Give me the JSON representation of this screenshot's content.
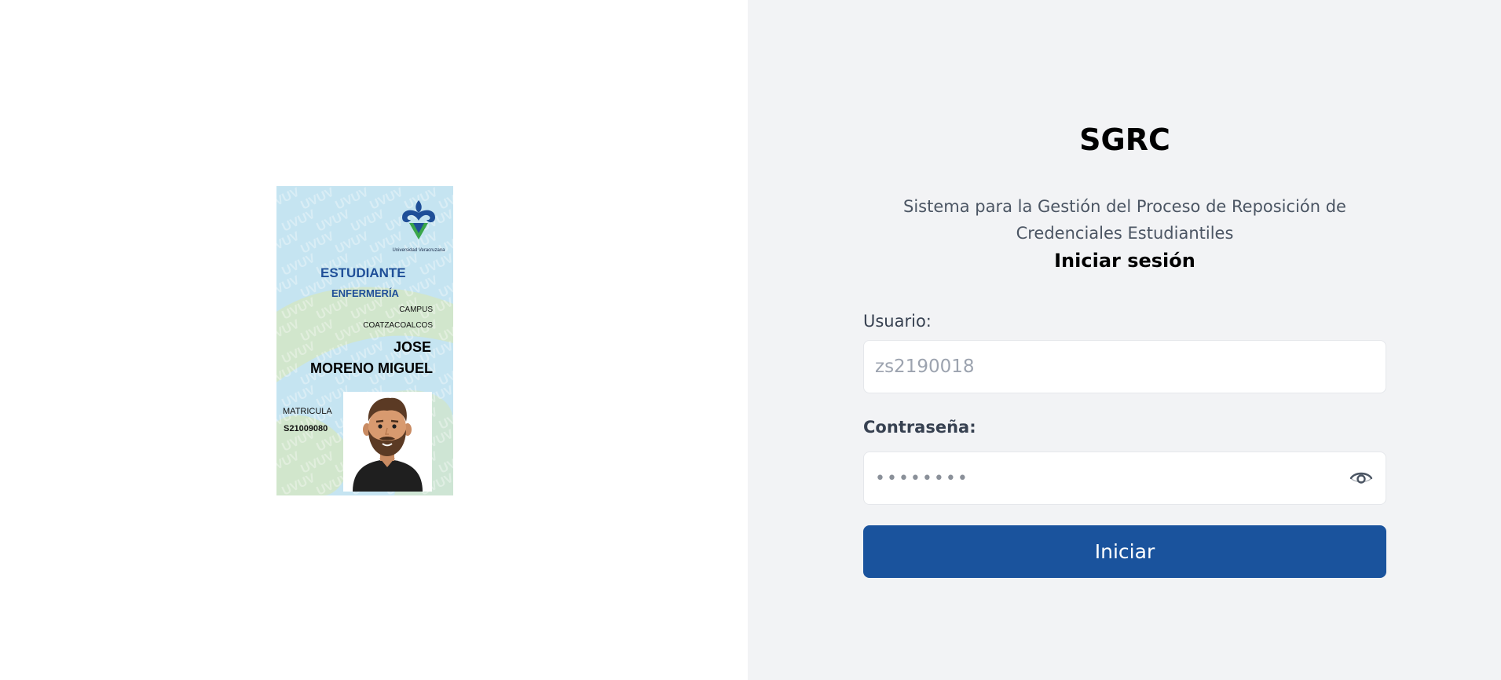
{
  "card": {
    "university": "Universidad Veracruzana",
    "watermark": "UV",
    "role": "ESTUDIANTE",
    "program": "ENFERMERÍA",
    "campus_label": "CAMPUS",
    "campus_name": "COATZACOALCOS",
    "first_name": "JOSE",
    "last_name": "MORENO MIGUEL",
    "matricula_label": "MATRICULA",
    "matricula": "S21009080",
    "colors": {
      "background": "#c5e4f1",
      "blob": "#d2e6c8",
      "brand_blue": "#1f4f98",
      "brand_green": "#3aa64a"
    }
  },
  "login": {
    "title": "SGRC",
    "subtitle": "Sistema para la Gestión del Proceso de Reposición de Credenciales Estudiantiles",
    "heading": "Iniciar sesión",
    "user_label": "Usuario:",
    "user_placeholder": "zs2190018",
    "password_label": "Contraseña:",
    "password_placeholder": "••••••••",
    "password_toggle_icon": "eye-icon",
    "submit_label": "Iniciar",
    "colors": {
      "panel_bg": "#f2f3f5",
      "button": "#1a539d",
      "button_text": "#ffffff"
    }
  }
}
